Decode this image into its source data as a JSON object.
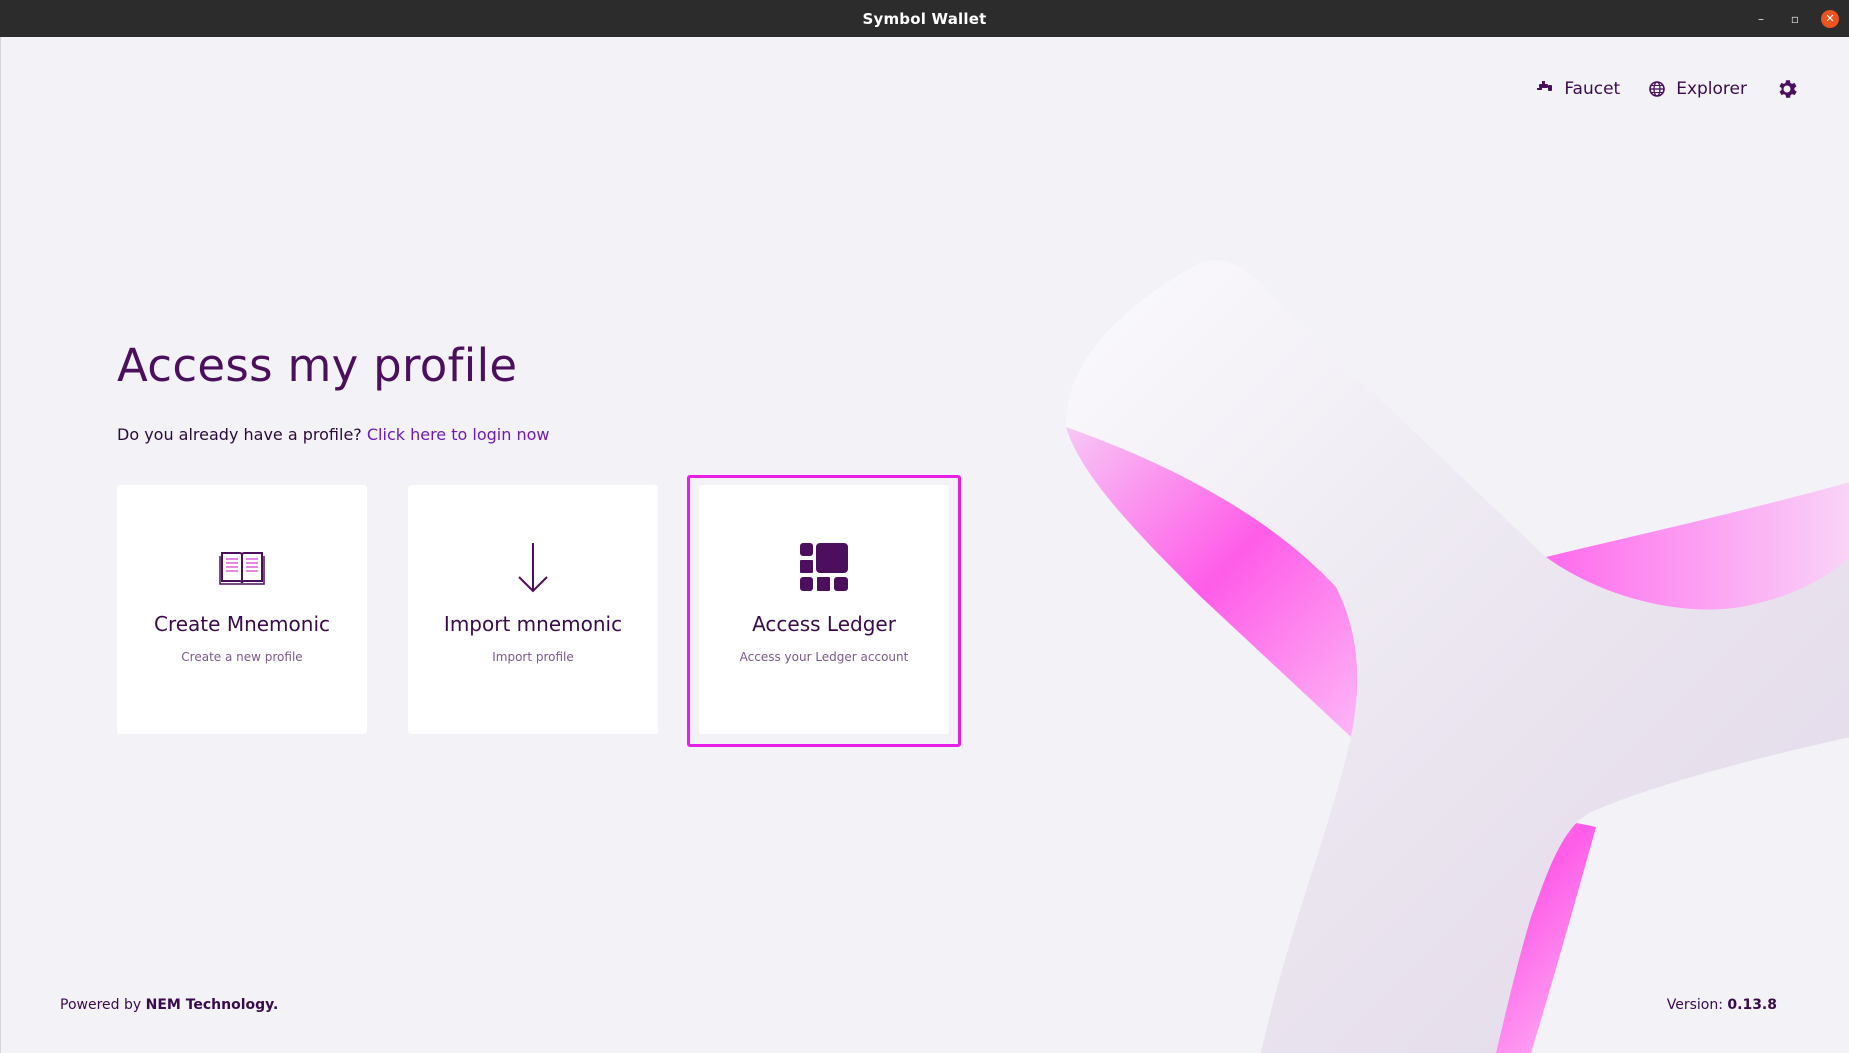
{
  "window": {
    "title": "Symbol Wallet",
    "minimize": "–",
    "maximize": "▫",
    "close": "✕"
  },
  "nav": {
    "faucet_label": "Faucet",
    "explorer_label": "Explorer"
  },
  "main": {
    "heading": "Access my profile",
    "prompt": "Do you already have a profile?",
    "login_link": "Click here to login now"
  },
  "cards": [
    {
      "title": "Create Mnemonic",
      "subtitle": "Create a new profile",
      "icon": "book-icon"
    },
    {
      "title": "Import mnemonic",
      "subtitle": "Import profile",
      "icon": "arrow-down-icon"
    },
    {
      "title": "Access Ledger",
      "subtitle": "Access your Ledger account",
      "icon": "ledger-icon",
      "selected": true
    }
  ],
  "footer": {
    "powered_by": "Powered by",
    "company": "NEM Technology.",
    "version_label": "Version:",
    "version": "0.13.8"
  },
  "colors": {
    "brand": "#4b0f5e",
    "link": "#6e1ab8",
    "highlight": "#e61ee6",
    "titlebar": "#2c2c2c"
  }
}
